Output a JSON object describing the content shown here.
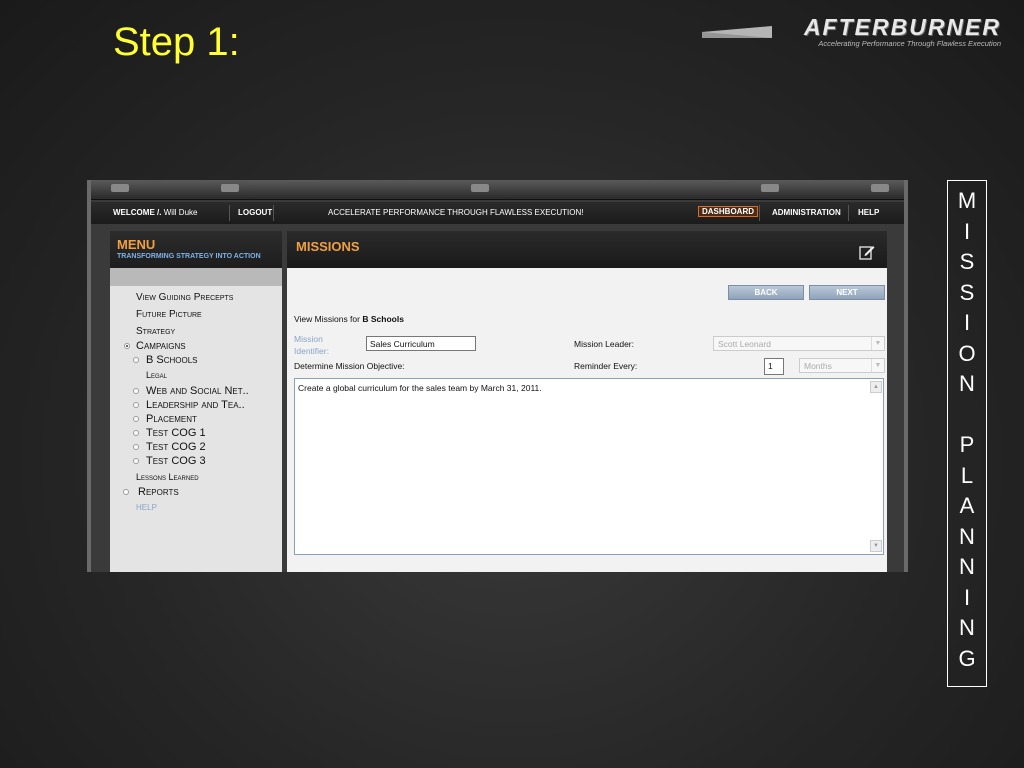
{
  "slide": {
    "title": "Step 1:",
    "vertical_label": [
      "M",
      "I",
      "S",
      "S",
      "I",
      "O",
      "N",
      "",
      "P",
      "L",
      "A",
      "N",
      "N",
      "I",
      "N",
      "G"
    ]
  },
  "logo": {
    "name": "AFTERBURNER",
    "tagline": "Accelerating Performance Through Flawless Execution"
  },
  "topbar": {
    "welcome": "WELCOME /.",
    "user": "Will Duke",
    "logout": "LOGOUT",
    "slogan": "ACCELERATE PERFORMANCE THROUGH FLAWLESS EXECUTION!",
    "dashboard": "DASHBOARD",
    "administration": "ADMINISTRATION",
    "help": "HELP"
  },
  "menu": {
    "title": "MENU",
    "subtitle": "TRANSFORMING STRATEGY INTO ACTION",
    "items": [
      {
        "label": "View Guiding Precepts"
      },
      {
        "label": "Future Picture"
      },
      {
        "label": "Strategy"
      },
      {
        "label": "Campaigns"
      },
      {
        "label": "B Schools"
      },
      {
        "label": "Legal"
      },
      {
        "label": "Web and Social Net.."
      },
      {
        "label": "Leadership and Tea.."
      },
      {
        "label": "Placement"
      },
      {
        "label": "Test COG 1"
      },
      {
        "label": "Test COG 2"
      },
      {
        "label": "Test COG 3"
      },
      {
        "label": "Lessons Learned"
      },
      {
        "label": "Reports"
      },
      {
        "label": "HELP"
      }
    ]
  },
  "missions": {
    "title": "MISSIONS",
    "back": "BACK",
    "next": "NEXT",
    "view_prefix": "View Missions for",
    "view_target": "B Schools",
    "identifier_label_1": "Mission",
    "identifier_label_2": "Identifier:",
    "identifier_value": "Sales Curriculum",
    "leader_label": "Mission Leader:",
    "leader_value": "Scott Leonard",
    "objective_label": "Determine Mission Objective:",
    "reminder_label": "Reminder Every:",
    "reminder_value": "1",
    "reminder_unit": "Months",
    "objective_text": "Create a global curriculum for the sales team by March 31, 2011."
  },
  "icons": {
    "edit": "edit-icon",
    "dropdown": "chevron-down-icon",
    "radio": "radio-icon"
  },
  "colors": {
    "title": "#ffff33",
    "accent": "#f0a040",
    "link_blue": "#7fb2e8"
  }
}
